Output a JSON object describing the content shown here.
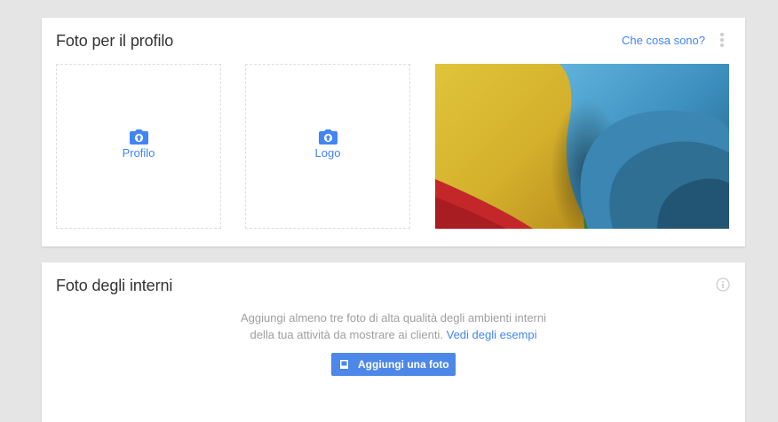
{
  "profile_photos": {
    "title": "Foto per il profilo",
    "help_link": "Che cosa sono?",
    "menu_icon": "more-vert-icon",
    "uploads": [
      {
        "label": "Profilo",
        "icon": "camera-icon"
      },
      {
        "label": "Logo",
        "icon": "camera-icon"
      }
    ],
    "cover_photo": {
      "colors": [
        "#d9b92e",
        "#c4272a",
        "#4a9fcf",
        "#2d7297",
        "#2f8a3a"
      ]
    }
  },
  "interior_photos": {
    "title": "Foto degli interni",
    "info_icon": "info-icon",
    "description_line1": "Aggiungi almeno tre foto di alta qualità degli ambienti interni",
    "description_line2": "della tua attività da mostrare ai clienti.",
    "examples_link": "Vedi degli esempi",
    "add_button": {
      "label": "Aggiungi una foto",
      "icon": "photo-icon"
    }
  },
  "colors": {
    "accent": "#4285f4",
    "button": "#4d88e8",
    "page_background": "#e5e5e5"
  }
}
